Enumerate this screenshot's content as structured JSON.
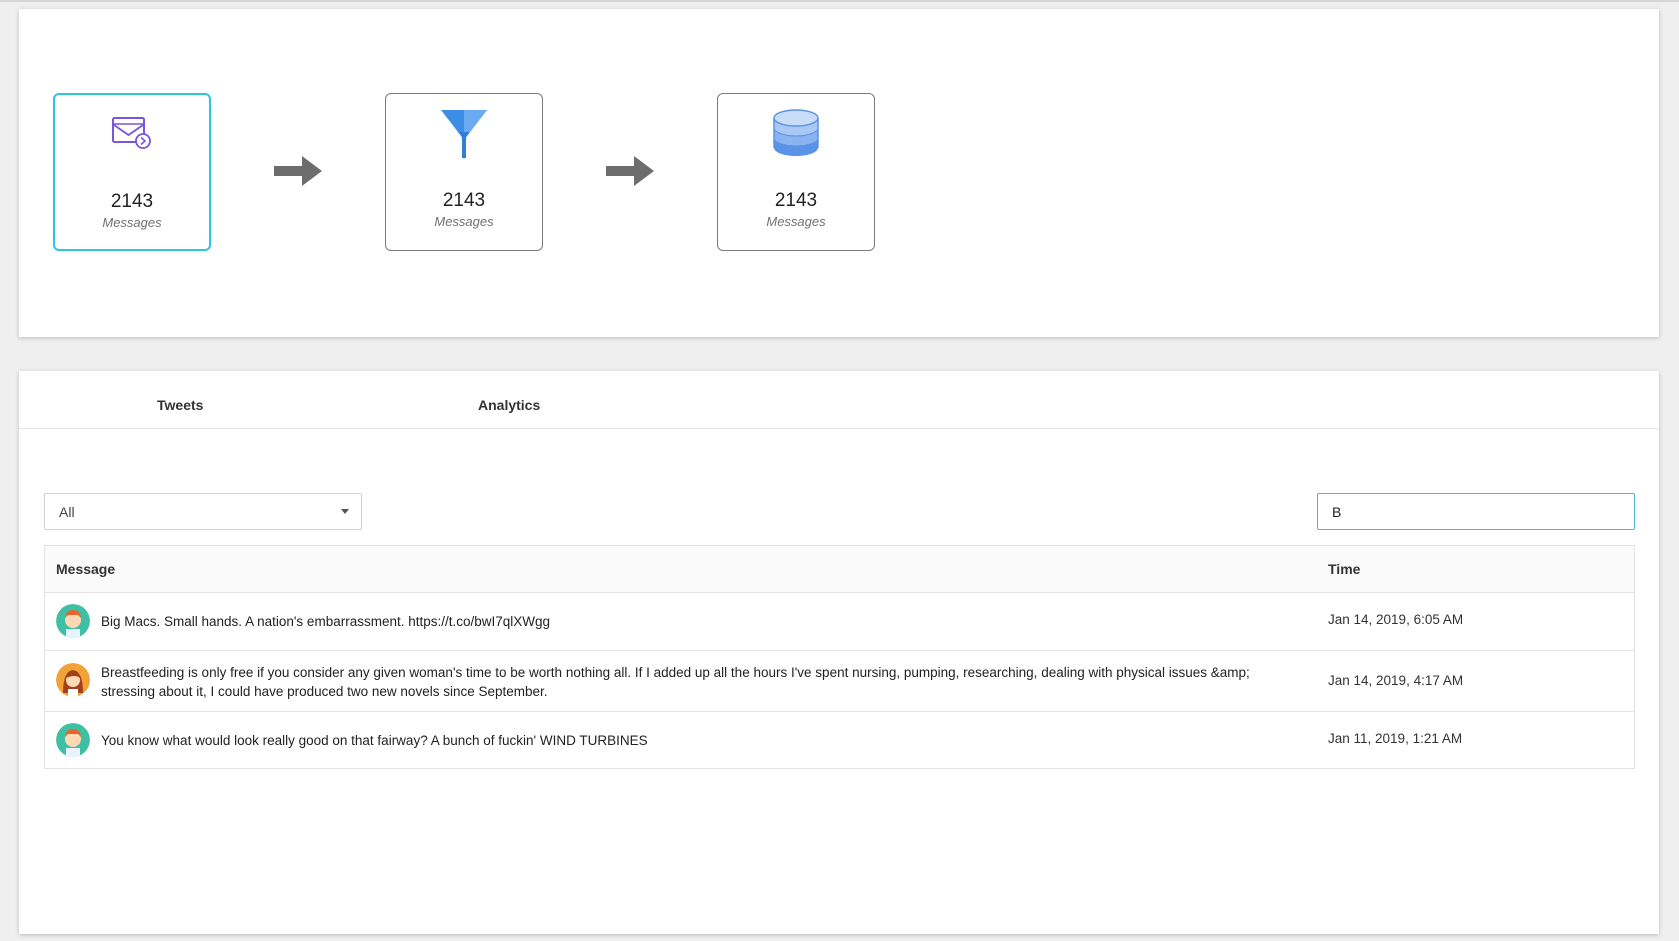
{
  "pipeline": {
    "stages": [
      {
        "count": "2143",
        "unit": "Messages",
        "icon": "mail-icon"
      },
      {
        "count": "2143",
        "unit": "Messages",
        "icon": "funnel-icon"
      },
      {
        "count": "2143",
        "unit": "Messages",
        "icon": "database-icon"
      }
    ],
    "accent_color": "#2fc3e6"
  },
  "tabs": [
    {
      "label": "Tweets"
    },
    {
      "label": "Analytics"
    }
  ],
  "filter": {
    "selected": "All"
  },
  "search": {
    "value": "B"
  },
  "table": {
    "headers": {
      "message": "Message",
      "time": "Time"
    },
    "rows": [
      {
        "avatar": "male-avatar-icon",
        "message": "Big Macs. Small hands. A nation's embarrassment. https://t.co/bwI7qlXWgg",
        "time": "Jan 14, 2019, 6:05 AM"
      },
      {
        "avatar": "female-avatar-icon",
        "message": "Breastfeeding is only free if you consider any given woman's time to be worth nothing all. If I added up all the hours I've spent nursing, pumping, researching, dealing with physical issues &amp; stressing about it, I could have produced two new novels since September.",
        "time": "Jan 14, 2019, 4:17 AM"
      },
      {
        "avatar": "male-avatar-icon",
        "message": "You know what would look really good on that fairway? A bunch of fuckin' WIND TURBINES",
        "time": "Jan 11, 2019, 1:21 AM"
      }
    ]
  }
}
